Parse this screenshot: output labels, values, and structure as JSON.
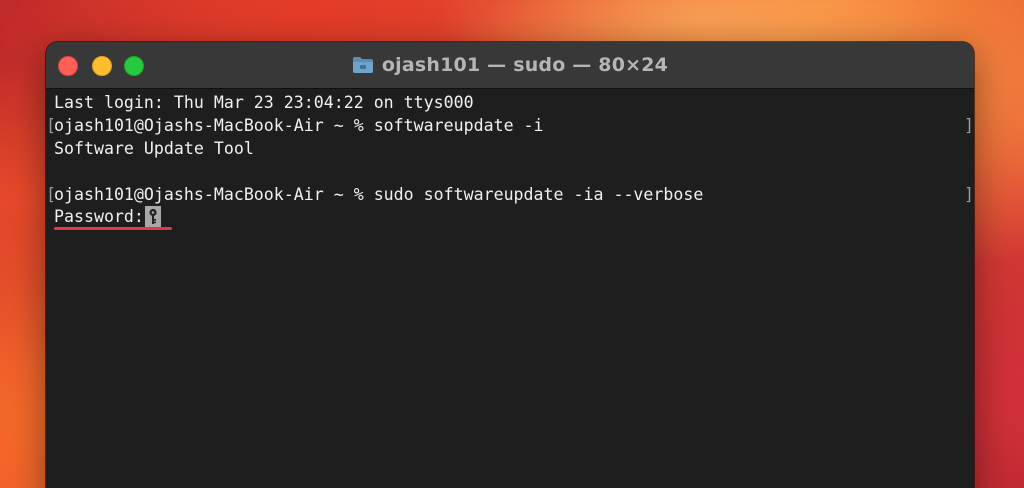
{
  "window": {
    "title": "ojash101 — sudo — 80×24"
  },
  "terminal": {
    "lines": [
      "Last login: Thu Mar 23 23:04:22 on ttys000",
      "ojash101@Ojashs-MacBook-Air ~ % softwareupdate -i",
      "Software Update Tool",
      "",
      "ojash101@Ojashs-MacBook-Air ~ % sudo softwareupdate -ia --verbose"
    ],
    "prompt_bracket_left": "[",
    "prompt_bracket_right": "]",
    "password_prompt": "Password:"
  },
  "icons": {
    "folder": "folder-icon",
    "cursor": "key-icon"
  },
  "colors": {
    "highlight_underline": "#e5364a",
    "close": "#ff5f57",
    "minimize": "#febc2e",
    "zoom": "#28c840"
  }
}
